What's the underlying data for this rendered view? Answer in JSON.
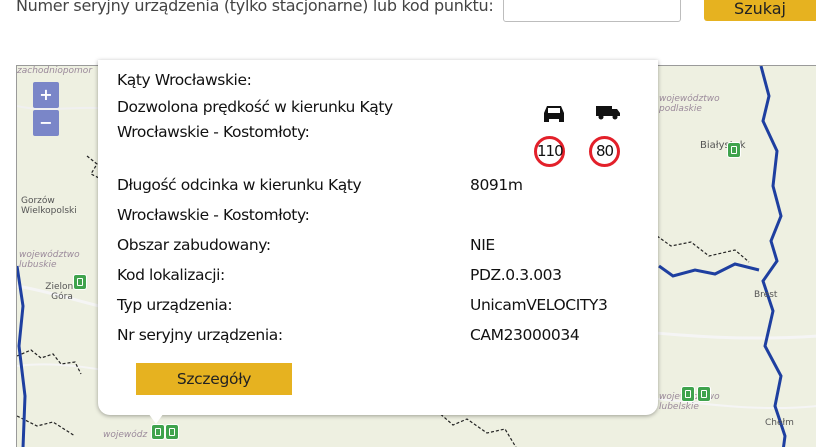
{
  "search": {
    "label": "Numer seryjny urządzenia (tylko stacjonarne) lub kod punktu:",
    "value": "",
    "button_label": "Szukaj"
  },
  "map": {
    "zoom_in": "+",
    "zoom_out": "−",
    "region_labels": [
      "zachodniopomor",
      "województwo podlaskie",
      "województwo lubuskie",
      "województwo lubelskie",
      "wojewódz"
    ],
    "cities": [
      "Białystok",
      "Gorzów Wielkopolski",
      "Zielona Góra",
      "Brest",
      "Chełm"
    ],
    "colors": {
      "land": "#eef0e1",
      "border": "#1e3fa0",
      "marker": "#3fa34d"
    }
  },
  "popup": {
    "heading": "Kąty Wrocławskie:",
    "speed_heading_line1": "Dozwolona prędkość w kierunku Kąty",
    "speed_heading_line2": "Wrocławskie - Kostomłoty:",
    "speed_car": "110",
    "speed_truck": "80",
    "rows": [
      {
        "label": "Długość odcinka w kierunku Kąty",
        "value": "8091m"
      },
      {
        "label": "Wrocławskie - Kostomłoty:",
        "value": ""
      },
      {
        "label": "Obszar zabudowany:",
        "value": "NIE"
      },
      {
        "label": "Kod lokalizacji:",
        "value": "PDZ.0.3.003"
      },
      {
        "label": "Typ urządzenia:",
        "value": "UnicamVELOCITY3"
      },
      {
        "label": "Nr seryjny urządzenia:",
        "value": "CAM23000034"
      }
    ],
    "details_button": "Szczegóły",
    "colors": {
      "button": "#e6b220",
      "sign_border": "#e3202a"
    }
  }
}
